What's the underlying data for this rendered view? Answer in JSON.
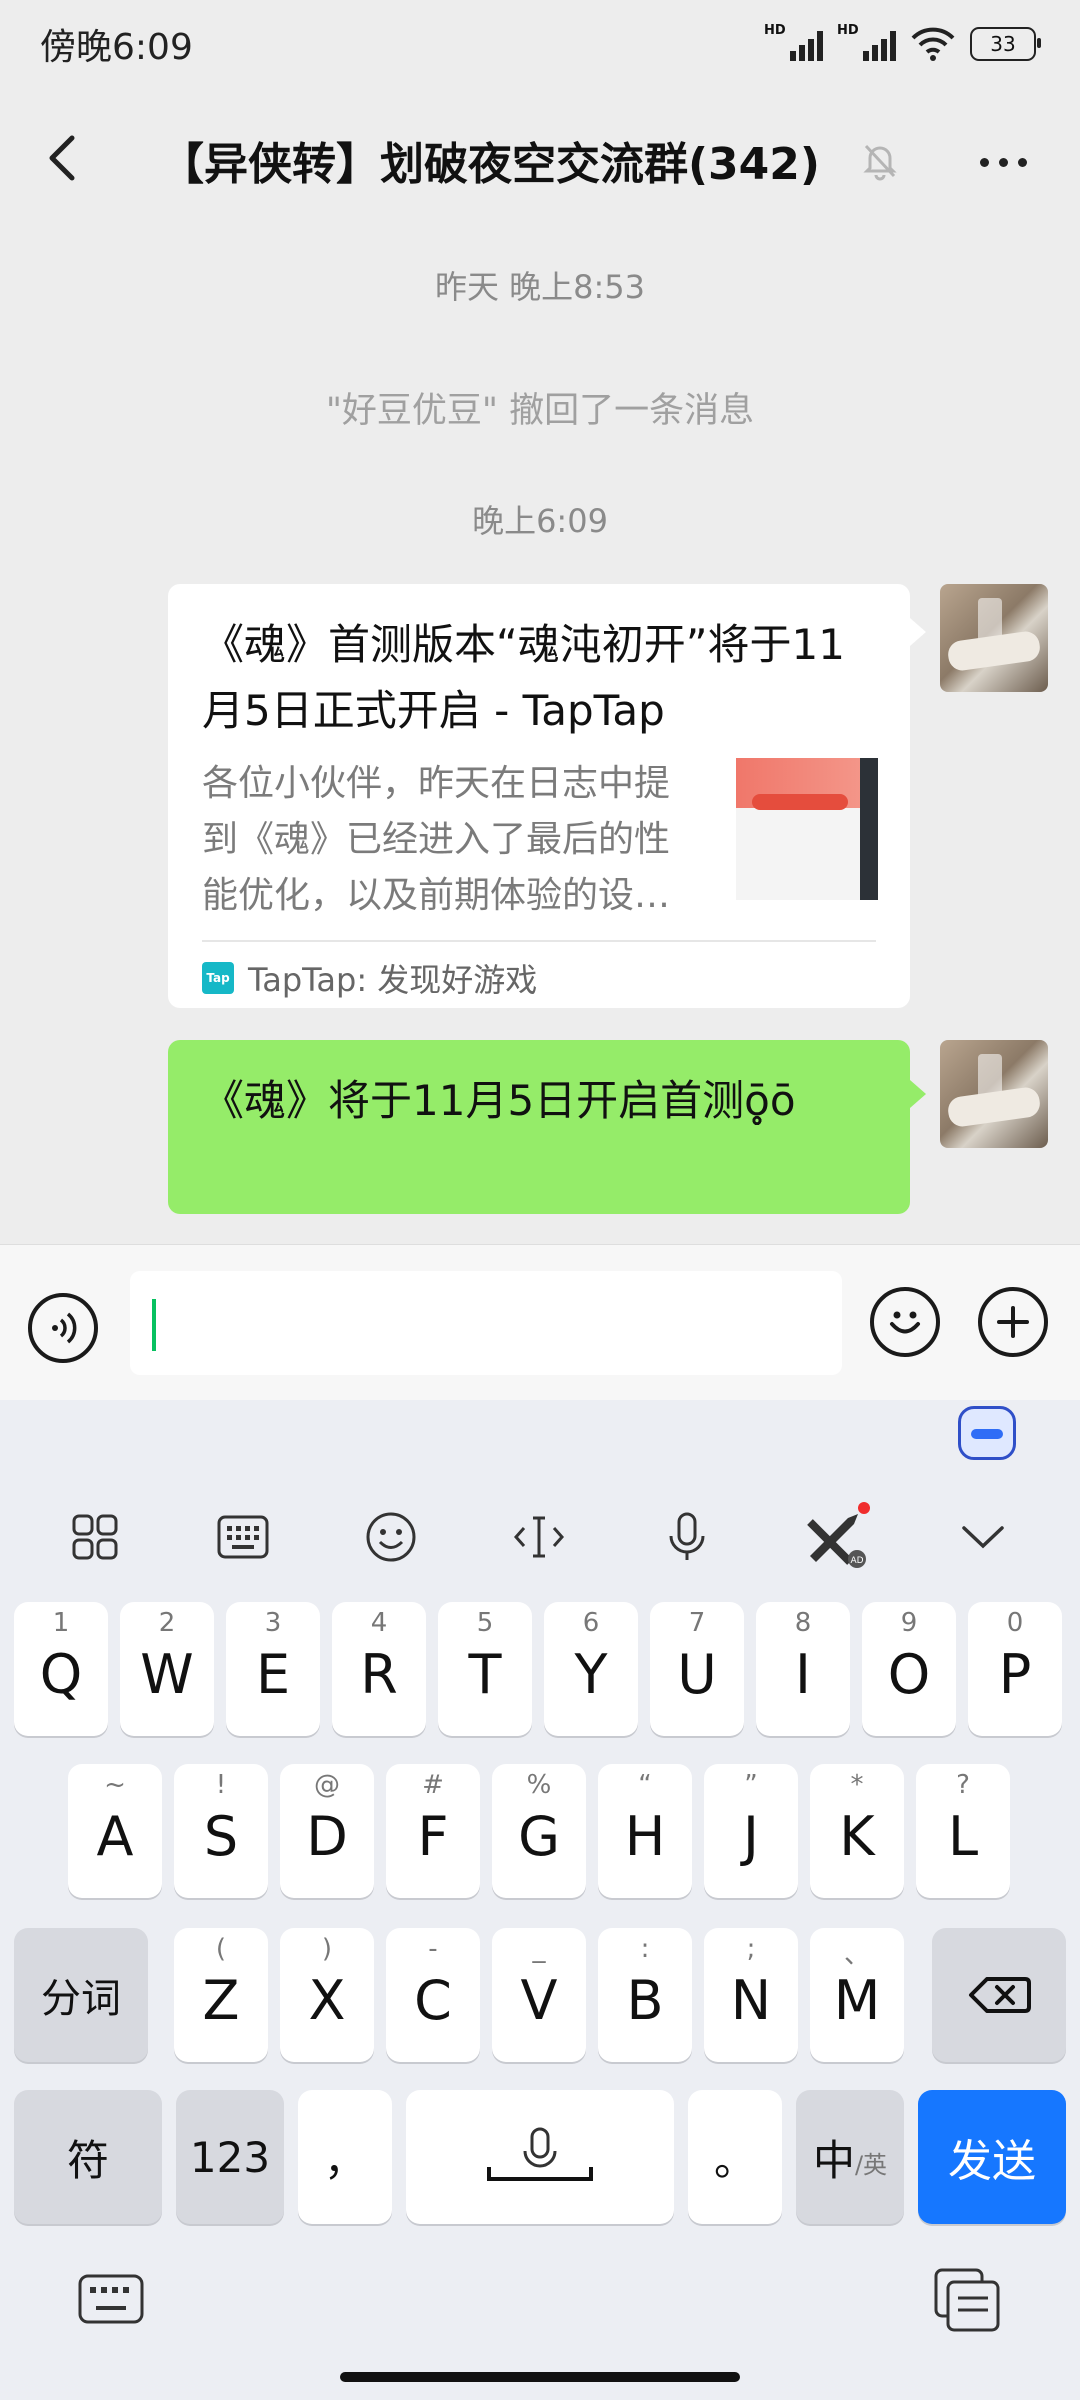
{
  "status_bar": {
    "time": "傍晚6:09",
    "network1": "HD",
    "network2": "HD",
    "battery": "33"
  },
  "nav": {
    "title": "【异侠转】划破夜空交流群(342)"
  },
  "chat": {
    "timestamp_yesterday": "昨天 晚上8:53",
    "recall_notice": "\"好豆优豆\" 撤回了一条消息",
    "timestamp_today": "晚上6:09",
    "link_card": {
      "title": "《魂》首测版本“魂沌初开”将于11月5日正式开启 - TapTap",
      "description": "各位小伙伴，昨天在日志中提到《魂》已经进入了最后的性能优化，以及前期体验的设…",
      "logo_text": "Tap",
      "source": "TapTap: 发现好游戏"
    },
    "text_message": "《魂》将于11月5日开启首测ō̥̥̥̥̥̥ō"
  },
  "input": {
    "value": ""
  },
  "keyboard": {
    "row1": [
      {
        "num": "1",
        "letter": "Q"
      },
      {
        "num": "2",
        "letter": "W"
      },
      {
        "num": "3",
        "letter": "E"
      },
      {
        "num": "4",
        "letter": "R"
      },
      {
        "num": "5",
        "letter": "T"
      },
      {
        "num": "6",
        "letter": "Y"
      },
      {
        "num": "7",
        "letter": "U"
      },
      {
        "num": "8",
        "letter": "I"
      },
      {
        "num": "9",
        "letter": "O"
      },
      {
        "num": "0",
        "letter": "P"
      }
    ],
    "row2": [
      {
        "sym": "~",
        "letter": "A"
      },
      {
        "sym": "!",
        "letter": "S"
      },
      {
        "sym": "@",
        "letter": "D"
      },
      {
        "sym": "#",
        "letter": "F"
      },
      {
        "sym": "%",
        "letter": "G"
      },
      {
        "sym": "“",
        "letter": "H"
      },
      {
        "sym": "”",
        "letter": "J"
      },
      {
        "sym": "*",
        "letter": "K"
      },
      {
        "sym": "?",
        "letter": "L"
      }
    ],
    "row3": [
      {
        "sym": "(",
        "letter": "Z"
      },
      {
        "sym": ")",
        "letter": "X"
      },
      {
        "sym": "-",
        "letter": "C"
      },
      {
        "sym": "_",
        "letter": "V"
      },
      {
        "sym": ":",
        "letter": "B"
      },
      {
        "sym": ";",
        "letter": "N"
      },
      {
        "sym": "、",
        "letter": "M"
      }
    ],
    "fenci": "分词",
    "fu": "符",
    "num_switch": "123",
    "comma": "，",
    "period": "。",
    "lang_main": "中",
    "lang_sub": "/英",
    "send": "发送",
    "ad_badge": "AD"
  }
}
